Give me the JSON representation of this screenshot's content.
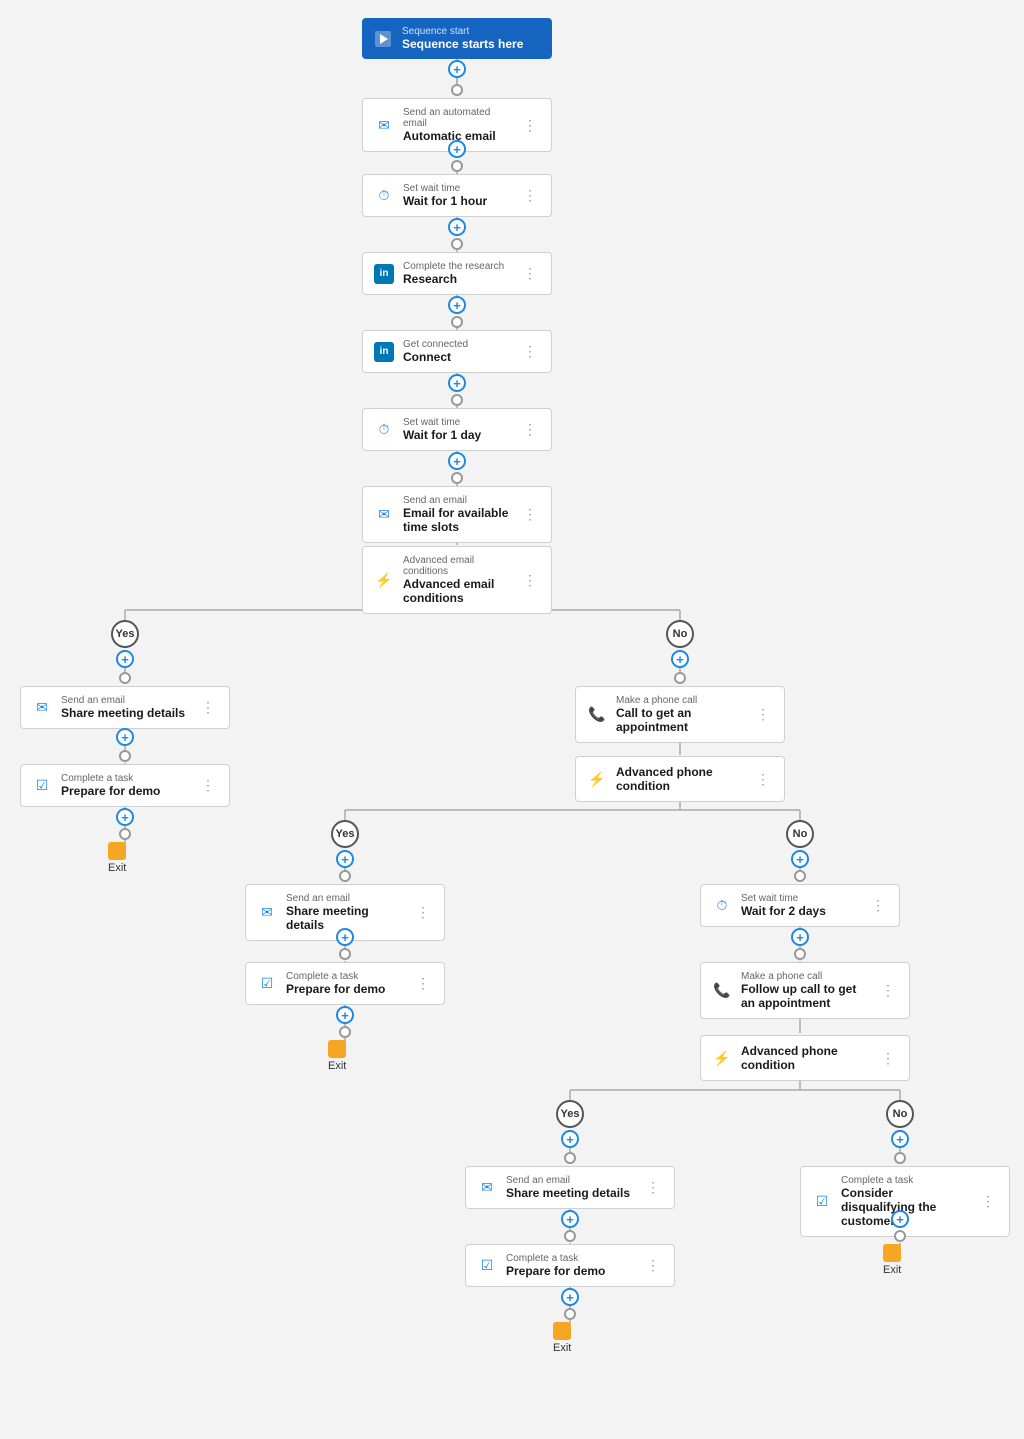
{
  "nodes": {
    "sequence_start": {
      "label": "Sequence start",
      "title": "Sequence starts here"
    },
    "automated_email": {
      "label": "Send an automated email",
      "title": "Automatic email"
    },
    "wait_1hour": {
      "label": "Set wait time",
      "title": "Wait for 1 hour"
    },
    "research": {
      "label": "Complete the research",
      "title": "Research"
    },
    "connect": {
      "label": "Get connected",
      "title": "Connect"
    },
    "wait_1day": {
      "label": "Set wait time",
      "title": "Wait for 1 day"
    },
    "email_timeslots": {
      "label": "Send an email",
      "title": "Email for available time slots"
    },
    "advanced_email_cond": {
      "label": "Advanced email conditions",
      "title": "Advanced email conditions"
    },
    "yes_label": "Yes",
    "no_label": "No",
    "share_meeting_yes": {
      "label": "Send an email",
      "title": "Share meeting details"
    },
    "prepare_demo_yes": {
      "label": "Complete a task",
      "title": "Prepare for demo"
    },
    "call_appointment": {
      "label": "Make a phone call",
      "title": "Call to get an appointment"
    },
    "advanced_phone_cond1": {
      "label": "",
      "title": "Advanced phone condition"
    },
    "yes2_label": "Yes",
    "no2_label": "No",
    "share_meeting_yes2": {
      "label": "Send an email",
      "title": "Share meeting details"
    },
    "prepare_demo_yes2": {
      "label": "Complete a task",
      "title": "Prepare for demo"
    },
    "wait_2days": {
      "label": "Set wait time",
      "title": "Wait for 2 days"
    },
    "followup_call": {
      "label": "Make a phone call",
      "title": "Follow up call to get an appointment"
    },
    "advanced_phone_cond2": {
      "label": "",
      "title": "Advanced phone condition"
    },
    "yes3_label": "Yes",
    "no3_label": "No",
    "share_meeting_yes3": {
      "label": "Send an email",
      "title": "Share meeting details"
    },
    "prepare_demo_yes3": {
      "label": "Complete a task",
      "title": "Prepare for demo"
    },
    "disqualify": {
      "label": "Complete a task",
      "title": "Consider disqualifying the customer"
    },
    "exit_label": "Exit"
  }
}
